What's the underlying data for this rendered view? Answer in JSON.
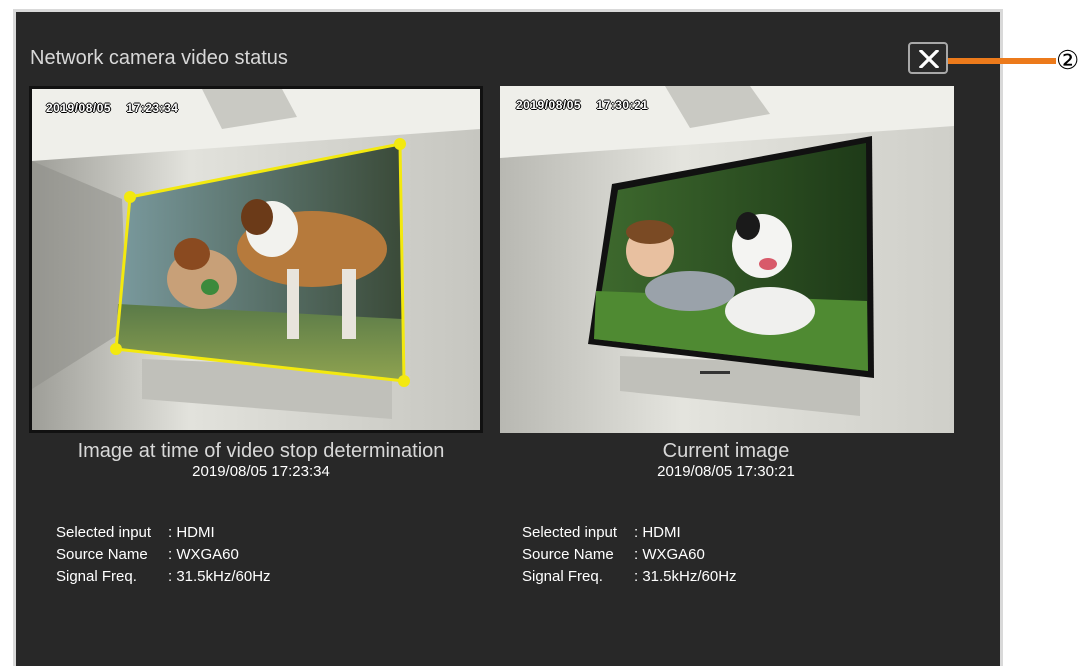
{
  "dialog": {
    "title": "Network camera video status",
    "close_label": "✕"
  },
  "left": {
    "timestamp": "2019/08/05    17:23:34",
    "caption": "Image at time of video stop determination",
    "time": "2019/08/05 17:23:34",
    "info": [
      {
        "key": "Selected input",
        "value": ": HDMI"
      },
      {
        "key": "Source Name",
        "value": ": WXGA60"
      },
      {
        "key": "Signal Freq.",
        "value": ": 31.5kHz/60Hz"
      }
    ]
  },
  "right": {
    "timestamp": "2019/08/05    17:30:21",
    "caption": "Current image",
    "time": "2019/08/05 17:30:21",
    "info": [
      {
        "key": "Selected input",
        "value": ": HDMI"
      },
      {
        "key": "Source Name",
        "value": ": WXGA60"
      },
      {
        "key": "Signal Freq.",
        "value": ": 31.5kHz/60Hz"
      }
    ]
  },
  "callout": {
    "number": "②",
    "color": "#ec7a1b"
  },
  "colors": {
    "dialog_bg": "#282828",
    "highlight": "#f3e90f"
  }
}
